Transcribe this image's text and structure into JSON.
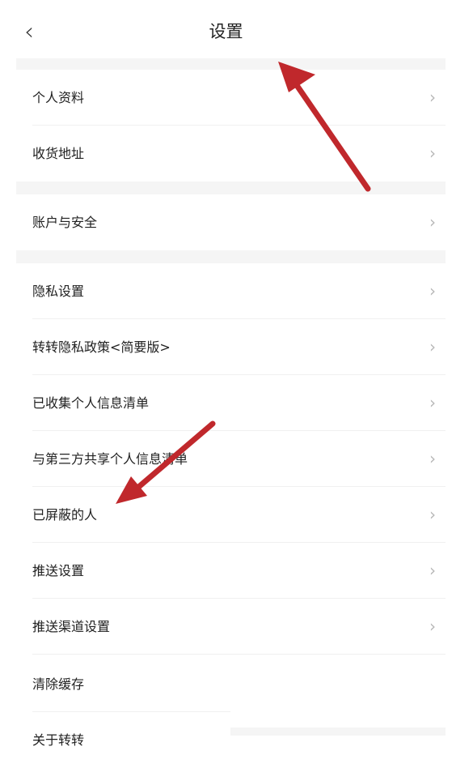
{
  "header": {
    "back_icon": "‹",
    "title": "设置"
  },
  "chevron": "›",
  "groups": [
    {
      "items": [
        {
          "label": "个人资料"
        },
        {
          "label": "收货地址"
        }
      ]
    },
    {
      "items": [
        {
          "label": "账户与安全"
        }
      ]
    },
    {
      "items": [
        {
          "label": "隐私设置"
        },
        {
          "label": "转转隐私政策<简要版>"
        },
        {
          "label": "已收集个人信息清单"
        },
        {
          "label": "与第三方共享个人信息清单"
        },
        {
          "label": "已屏蔽的人"
        },
        {
          "label": "推送设置"
        },
        {
          "label": "推送渠道设置"
        },
        {
          "label": "清除缓存"
        },
        {
          "label": "关于转转"
        }
      ]
    }
  ],
  "annotation_color": "#c0282c"
}
